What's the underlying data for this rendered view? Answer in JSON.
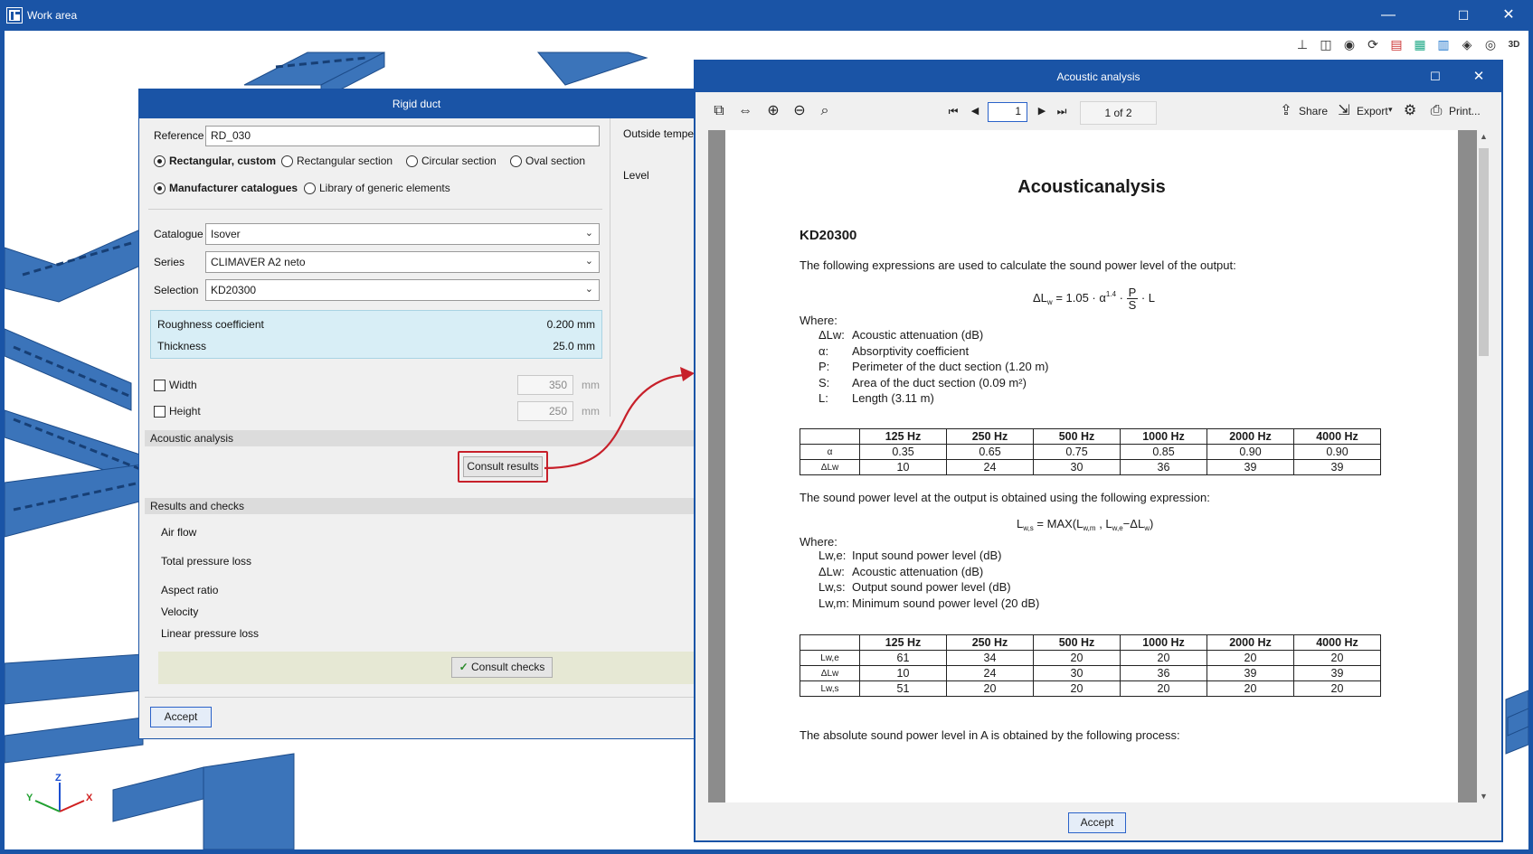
{
  "window": {
    "title": "Work area",
    "controls": [
      "—",
      "☐",
      "✕"
    ]
  },
  "toolbar_icons": [
    "axes-icon",
    "cube-icon",
    "eye-icon",
    "rotate-icon",
    "layers-icon",
    "plan-icon",
    "grid-icon",
    "box-icon",
    "visibility-icon",
    "view-3d-icon"
  ],
  "axes": {
    "x": "X",
    "y": "Y",
    "z": "Z"
  },
  "rigid_duct": {
    "title": "Rigid duct",
    "reference_label": "Reference",
    "reference_value": "RD_030",
    "section_options": [
      "Rectangular, custom",
      "Rectangular section",
      "Circular section",
      "Oval section"
    ],
    "source_options": [
      "Manufacturer catalogues",
      "Library of generic elements"
    ],
    "catalogue_label": "Catalogue",
    "catalogue_value": "Isover",
    "series_label": "Series",
    "series_value": "CLIMAVER A2 neto",
    "selection_label": "Selection",
    "selection_value": "KD20300",
    "roughness_label": "Roughness coefficient",
    "roughness_value": "0.200 mm",
    "thickness_label": "Thickness",
    "thickness_value": "25.0 mm",
    "width_label": "Width",
    "width_value": "350",
    "height_label": "Height",
    "height_value": "250",
    "unit": "mm",
    "acoustic_section": "Acoustic analysis",
    "consult_results": "Consult results",
    "results_section": "Results and checks",
    "results": [
      "Air flow",
      "Total pressure loss",
      "Aspect ratio",
      "Velocity",
      "Linear pressure loss"
    ],
    "consult_checks": "Consult checks",
    "accept": "Accept",
    "outside_temp_label": "Outside tempe",
    "level_label": "Level"
  },
  "acoustic": {
    "title": "Acoustic analysis",
    "page_current": "1",
    "page_of": "1 of 2",
    "share": "Share",
    "export": "Export",
    "print": "Print...",
    "accept": "Accept",
    "doc": {
      "title": "Acousticanalysis",
      "subtitle": "KD20300",
      "intro": "The following expressions are used to calculate the sound power level of the output:",
      "where": "Where:",
      "where_items": [
        {
          "sym": "ΔLw:",
          "text": "Acoustic attenuation (dB)"
        },
        {
          "sym": "α:",
          "text": "Absorptivity coefficient"
        },
        {
          "sym": "P:",
          "text": "Perimeter of the duct section (1.20 m)"
        },
        {
          "sym": "S:",
          "text": "Area of the duct section (0.09 m²)"
        },
        {
          "sym": "L:",
          "text": "Length (3.11 m)"
        }
      ],
      "table1": {
        "headers": [
          "",
          "125 Hz",
          "250 Hz",
          "500 Hz",
          "1000 Hz",
          "2000 Hz",
          "4000 Hz"
        ],
        "rows": [
          [
            "α",
            "0.35",
            "0.65",
            "0.75",
            "0.85",
            "0.90",
            "0.90"
          ],
          [
            "ΔLw",
            "10",
            "24",
            "30",
            "36",
            "39",
            "39"
          ]
        ]
      },
      "intro2": "The sound power level at the output is obtained using the following expression:",
      "where2": "Where:",
      "where2_items": [
        {
          "sym": "Lw,e:",
          "text": "Input sound power level (dB)"
        },
        {
          "sym": "ΔLw:",
          "text": "Acoustic attenuation (dB)"
        },
        {
          "sym": "Lw,s:",
          "text": "Output sound power level (dB)"
        },
        {
          "sym": "Lw,m:",
          "text": "Minimum sound power level (20 dB)"
        }
      ],
      "table2": {
        "headers": [
          "",
          "125 Hz",
          "250 Hz",
          "500 Hz",
          "1000 Hz",
          "2000 Hz",
          "4000 Hz"
        ],
        "rows": [
          [
            "Lw,e",
            "61",
            "34",
            "20",
            "20",
            "20",
            "20"
          ],
          [
            "ΔLw",
            "10",
            "24",
            "30",
            "36",
            "39",
            "39"
          ],
          [
            "Lw,s",
            "51",
            "20",
            "20",
            "20",
            "20",
            "20"
          ]
        ]
      },
      "outro": "The absolute sound power level in A is obtained by the following process:"
    }
  }
}
